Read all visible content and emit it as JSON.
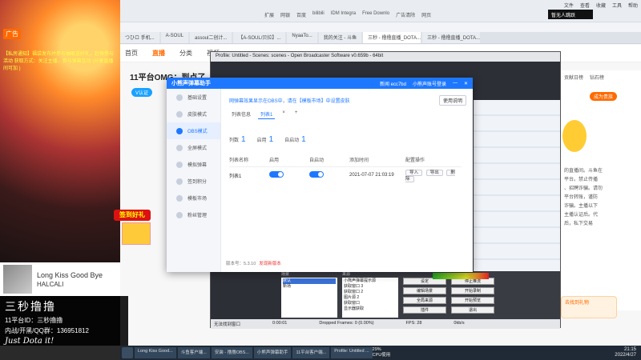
{
  "browser": {
    "menu": [
      "文件",
      "查看",
      "收藏",
      "工具",
      "帮助"
    ],
    "corner_badge": "暂无人跳跃",
    "bookmarks": [
      "扩展",
      "网银",
      "百度",
      "bilibili",
      "IDM Integra",
      "Free Downlo",
      "广告清除",
      "网页"
    ],
    "tabs": [
      "つひロ 手机...",
      "A-SOUL",
      "assoul二创计...",
      "【A-SOUL/贝拉】...",
      "NyaaTo...",
      "我的关注 - 斗鱼",
      "三秒 - 撸撸直播_DOTA...",
      "三秒 - 撸撸直播_DOTA..."
    ],
    "nav": [
      "首页",
      "直播",
      "分类",
      "视频"
    ],
    "stream_title": "11平台OMG：到点了，开吹",
    "host_badge": "V认证"
  },
  "right_panel": {
    "tabs": [
      "贡献日榜",
      "钻石榜"
    ],
    "pill": "成为贵族",
    "text": [
      "的直播间。斗鱼在",
      "平台。禁止传播",
      "、招聘诈骗。请勿",
      "平台转账，谨防",
      "诈骗。主播以下",
      "主播认证后。代",
      "后，私下交易"
    ],
    "promo": "去找到礼物"
  },
  "obs": {
    "title": "Profile: Untitled - Scenes: scenes - Open Broadcaster Software v0.659b - 64bit",
    "scenes_header": "场景",
    "sources_header": "来源",
    "scenes": [
      "默认",
      "新场"
    ],
    "sources": [
      "小熊声弹幕提示源",
      "获取窗口 3",
      "获取窗口 2",
      "图片源 2",
      "获取窗口",
      "显示器获取"
    ],
    "buttons": [
      "设定",
      "停止推流",
      "编辑场景",
      "开始录制",
      "全局来源",
      "开始预览",
      "插件",
      "退出"
    ],
    "status_left": "无法找到窗口",
    "status_time": "0:00:01",
    "status_fps": "FPS: 28",
    "status_drop": "Dropped Frames: 0 (0.00%)",
    "status_rate": "0kb/s"
  },
  "dialog": {
    "title": "小熊声弹幕助手",
    "login": "新闻 ecc7bd",
    "login_hint": "小熊声账号登录",
    "sidebar": [
      {
        "label": "基础设置",
        "icon": "settings-icon"
      },
      {
        "label": "皮肤模式",
        "icon": "skin-icon"
      },
      {
        "label": "OBS模式",
        "icon": "obs-icon"
      },
      {
        "label": "全屏模式",
        "icon": "fullscreen-icon"
      },
      {
        "label": "模拟弹幕",
        "icon": "danmu-icon"
      },
      {
        "label": "签到积分",
        "icon": "points-icon"
      },
      {
        "label": "模板市场",
        "icon": "market-icon"
      },
      {
        "label": "粉丝管理",
        "icon": "fans-icon"
      }
    ],
    "notice": "网弹幕效果显示在OBS中，请在【模板市场】中设置皮肤",
    "guide_btn": "使用说明",
    "sub_tabs": [
      "列表信息",
      "列表1",
      "×",
      "+"
    ],
    "stats": [
      {
        "label": "列数",
        "value": "1"
      },
      {
        "label": "启用",
        "value": "1"
      },
      {
        "label": "自启动",
        "value": "1"
      }
    ],
    "table_headers": [
      "列表名称",
      "启用",
      "自启动",
      "添加时间",
      "配置操作"
    ],
    "row": {
      "name": "列表1",
      "added": "2021-07-07 21:03:19",
      "actions": [
        "导入",
        "导出",
        "删除"
      ]
    },
    "version": "版本号：5.3.10",
    "update": "发现新版本"
  },
  "overlay": {
    "ad": "广告",
    "text": "【私房通知】福袋发布并参与抽取送好礼，赶快参与活动 获取方式：关注主播，参与弹幕互动 (分享直播间可加 )",
    "red_btn": "签到好礼",
    "song": "Long Kiss Good Bye",
    "artist": "HALCALI",
    "brand_name": "三秒撸撸",
    "brand_id": "11平台ID：三秒撸撸",
    "brand_qq": "内战/开黑/QQ群：136951812",
    "brand_slogan": "Just Dota it!"
  },
  "taskbar": {
    "tasks": [
      "Long Kiss Good...",
      "斗鱼客户端...",
      "安装 - 撸撸OBS...",
      "小熊声弹幕助手",
      "11平台客户端...",
      "Profile: Untitled ..."
    ],
    "cpu": "29%",
    "cpu_label": "CPU使用",
    "time": "21:15",
    "date": "2022/4/27"
  },
  "colors": {
    "accent": "#1e78ff",
    "brand": "#ff6a00",
    "danger": "#e33"
  }
}
